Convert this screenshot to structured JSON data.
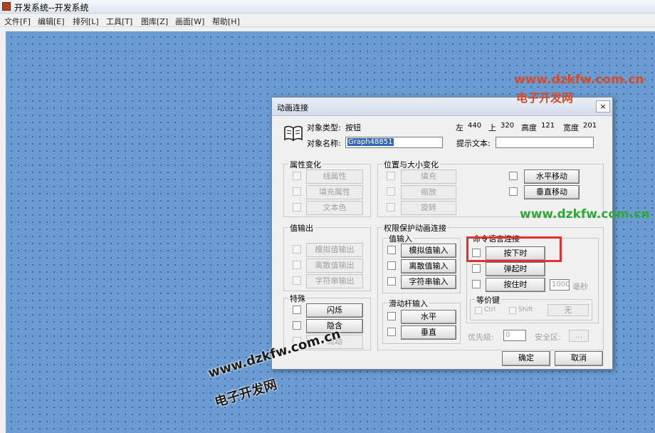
{
  "window": {
    "title": "开发系统--开发系统",
    "icon": "app-icon"
  },
  "menu": [
    "文件[F]",
    "编辑[E]",
    "排列[L]",
    "工具[T]",
    "图库[Z]",
    "画面[W]",
    "帮助[H]"
  ],
  "watermarks": {
    "top_url": "www.dzkfw.com.cn",
    "top_name": "电子开发网",
    "mid_url": "www.dzkfw.com.cn",
    "bottom_url": "www.dzkfw.com.cn",
    "bottom_name": "电子开发网"
  },
  "dialog": {
    "title": "动画连接",
    "close_label": "×",
    "icon": "book-icon",
    "object_type_label": "对象类型:",
    "object_type_value": "按钮",
    "object_name_label": "对象名称:",
    "object_name_value": "Graph48851",
    "prompt_label": "提示文本:",
    "prompt_value": "",
    "left_label": "左",
    "left_value": "440",
    "top_label": "上",
    "top_value": "320",
    "height_label": "高度",
    "height_value": "121",
    "width_label": "宽度",
    "width_value": "201",
    "attr": {
      "title": "属性变化",
      "items": [
        "线属性",
        "填充属性",
        "文本色"
      ]
    },
    "pos": {
      "title": "位置与大小变化",
      "left_items": [
        "填充",
        "缩放",
        "旋转"
      ],
      "right_items": [
        "水平移动",
        "垂直移动"
      ]
    },
    "valout": {
      "title": "值输出",
      "items": [
        "模拟值输出",
        "离散值输出",
        "字符串输出"
      ]
    },
    "special": {
      "title": "特殊",
      "items": [
        "闪烁",
        "隐含",
        "流动"
      ]
    },
    "perm": {
      "title": "权限保护动画连接",
      "valin": {
        "title": "值输入",
        "items": [
          "模拟值输入",
          "离散值输入",
          "字符串输入"
        ]
      },
      "slider": {
        "title": "滑动杆输入",
        "items": [
          "水平",
          "垂直"
        ]
      },
      "cmd": {
        "title": "命令语言连接",
        "items": [
          "按下时",
          "弹起时",
          "按住时"
        ],
        "interval_value": "1000",
        "interval_unit": "毫秒"
      },
      "hotkey": {
        "title": "等价键",
        "ctrl": "Ctrl",
        "shift": "Shift",
        "key_value": "无"
      },
      "priority_label": "优先级:",
      "priority_value": "0",
      "zone_label": "安全区:",
      "zone_button": "..."
    },
    "ok_label": "确定",
    "cancel_label": "取消"
  }
}
